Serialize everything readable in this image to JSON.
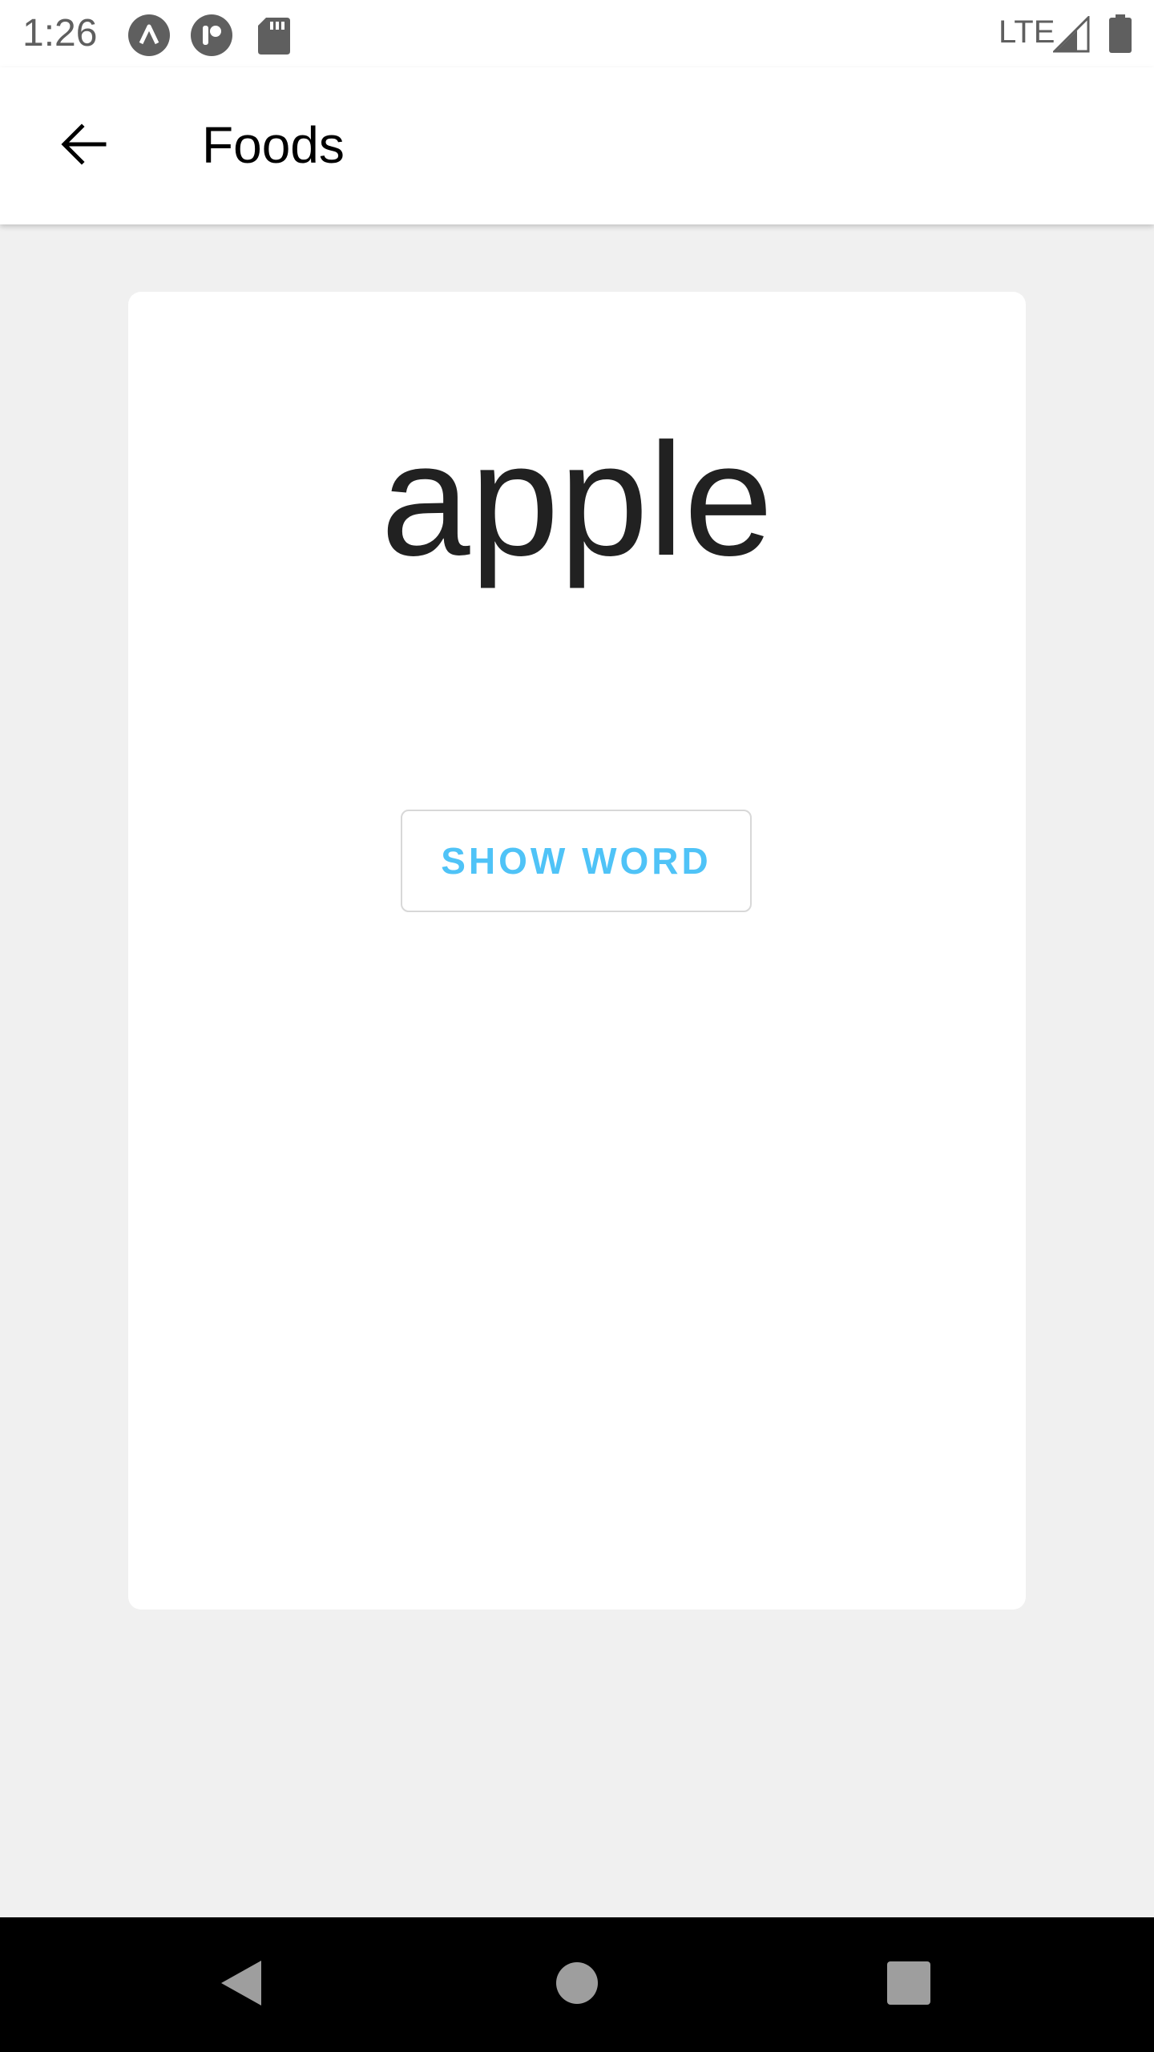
{
  "status_bar": {
    "time": "1:26",
    "network": "LTE",
    "icons": [
      "app-a-icon",
      "app-p-icon",
      "sd-card-icon",
      "signal-icon",
      "battery-icon"
    ]
  },
  "app_bar": {
    "title": "Foods",
    "back_icon": "arrow-back-icon"
  },
  "card": {
    "word": "apple",
    "button_label": "SHOW WORD"
  },
  "nav_bar": {
    "icons": [
      "back-triangle-icon",
      "home-circle-icon",
      "recents-square-icon"
    ]
  },
  "colors": {
    "background": "#f0f0f0",
    "card": "#ffffff",
    "accent": "#4fc3f7",
    "word_text": "#212121"
  }
}
